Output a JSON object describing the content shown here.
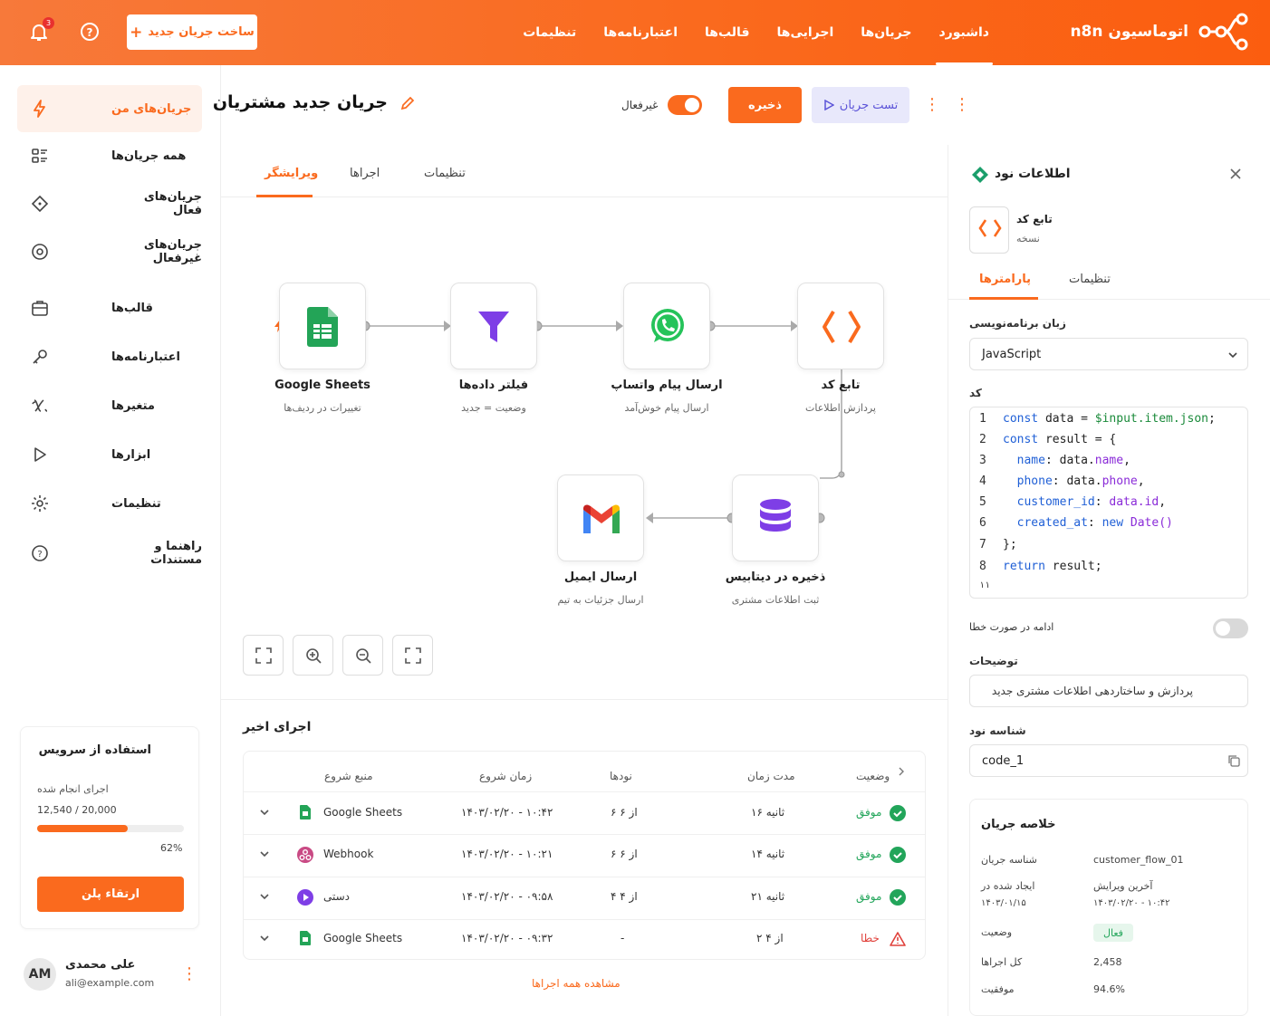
{
  "brand": {
    "name": "n8n اتوماسیون"
  },
  "nav": [
    "داشبورد",
    "جریان‌ها",
    "اجرایی‌ها",
    "قالب‌ها",
    "اعتبارنامه‌ها",
    "تنظیمات"
  ],
  "header": {
    "new_flow": "ساخت جریان جدید",
    "notif_count": "3"
  },
  "sidebar": {
    "items": [
      "جریان‌های من",
      "همه جریان‌ها",
      "جریان‌های فعال",
      "جریان‌های غیرفعال",
      "قالب‌ها",
      "اعتبارنامه‌ها",
      "متغیرها",
      "ابزارها",
      "تنظیمات",
      "راهنما و مستندات"
    ]
  },
  "usage": {
    "title": "استفاده از سرویس",
    "label": "اجرای انجام شده",
    "value": "12,540 / 20,000",
    "percent": "62%",
    "progress": 0.62,
    "upgrade": "ارتقاء پلن"
  },
  "user": {
    "name": "علی محمدی",
    "email": "ali@example.com",
    "initials": "AM"
  },
  "flow": {
    "title": "جریان جدید مشتریان",
    "toggle_label": "غیرفعال",
    "save": "ذخیره",
    "test": "تست جریان"
  },
  "tabs": [
    "ویرایشگر",
    "اجراها",
    "تنظیمات"
  ],
  "nodes": {
    "sheets": {
      "title": "Google Sheets",
      "sub": "تغییرات در ردیف‌ها"
    },
    "filter": {
      "title": "فیلتر داده‌ها",
      "sub": "وضعیت = جدید"
    },
    "whatsapp": {
      "title": "ارسال پیام واتساپ",
      "sub": "ارسال پیام خوش‌آمد"
    },
    "code": {
      "title": "تابع کد",
      "sub": "پردازش اطلاعات"
    },
    "db": {
      "title": "ذخیره در دیتابیس",
      "sub": "ثبت اطلاعات مشتری"
    },
    "email": {
      "title": "ارسال ایمیل",
      "sub": "ارسال جزئیات به تیم"
    }
  },
  "recent": {
    "title": "اجرای اخیر",
    "headers": [
      "وضعیت",
      "مدت زمان",
      "نودها",
      "زمان شروع",
      "منبع شروع"
    ],
    "rows": [
      {
        "status": "موفق",
        "duration": "۱۶ ثانیه",
        "nodes": "۶ از ۶",
        "start": "۱۴۰۳/۰۲/۲۰ - ۱۰:۴۲",
        "source": "Google Sheets"
      },
      {
        "status": "موفق",
        "duration": "۱۴ ثانیه",
        "nodes": "۶ از ۶",
        "start": "۱۴۰۳/۰۲/۲۰ - ۱۰:۲۱",
        "source": "Webhook"
      },
      {
        "status": "موفق",
        "duration": "۲۱ ثانیه",
        "nodes": "۴ از ۴",
        "start": "۱۴۰۳/۰۲/۲۰ - ۰۹:۵۸",
        "source": "دستی"
      },
      {
        "status": "خطا",
        "duration": "۲ از ۴",
        "nodes": "-",
        "start": "۱۴۰۳/۰۲/۲۰ - ۰۹:۳۲",
        "source": "Google Sheets"
      }
    ],
    "view_all": "مشاهده همه اجراها"
  },
  "panel": {
    "title": "اطلاعات نود",
    "node_name": "تابع کد",
    "node_sub": "نسخه",
    "tabs": [
      "پارامترها",
      "تنظیمات"
    ],
    "lang_label": "زبان برنامه‌نویسی",
    "lang": "JavaScript",
    "code_label": "کد",
    "continue_label": "ادامه در صورت خطا",
    "desc_label": "توضیحات",
    "desc": "پردازش و ساختاردهی اطلاعات مشتری جدید",
    "id_label": "شناسه نود",
    "id": "code_1"
  },
  "summary": {
    "title": "خلاصه جریان",
    "flow_id_label": "شناسه جریان",
    "flow_id": "customer_flow_01",
    "created_label": "ایجاد شده در",
    "created": "۱۴۰۳/۰۱/۱۵",
    "edited_label": "آخرین ویرایش",
    "edited": "۱۴۰۳/۰۲/۲۰ - ۱۰:۴۲",
    "status_label": "وضعیت",
    "status": "فعال",
    "runs_label": "کل اجراها",
    "runs": "2,458",
    "success_label": "موفقیت",
    "success": "94.6%"
  },
  "colors": {
    "accent": "#fa6a1e",
    "success": "#22a55a",
    "error": "#e0413b"
  }
}
